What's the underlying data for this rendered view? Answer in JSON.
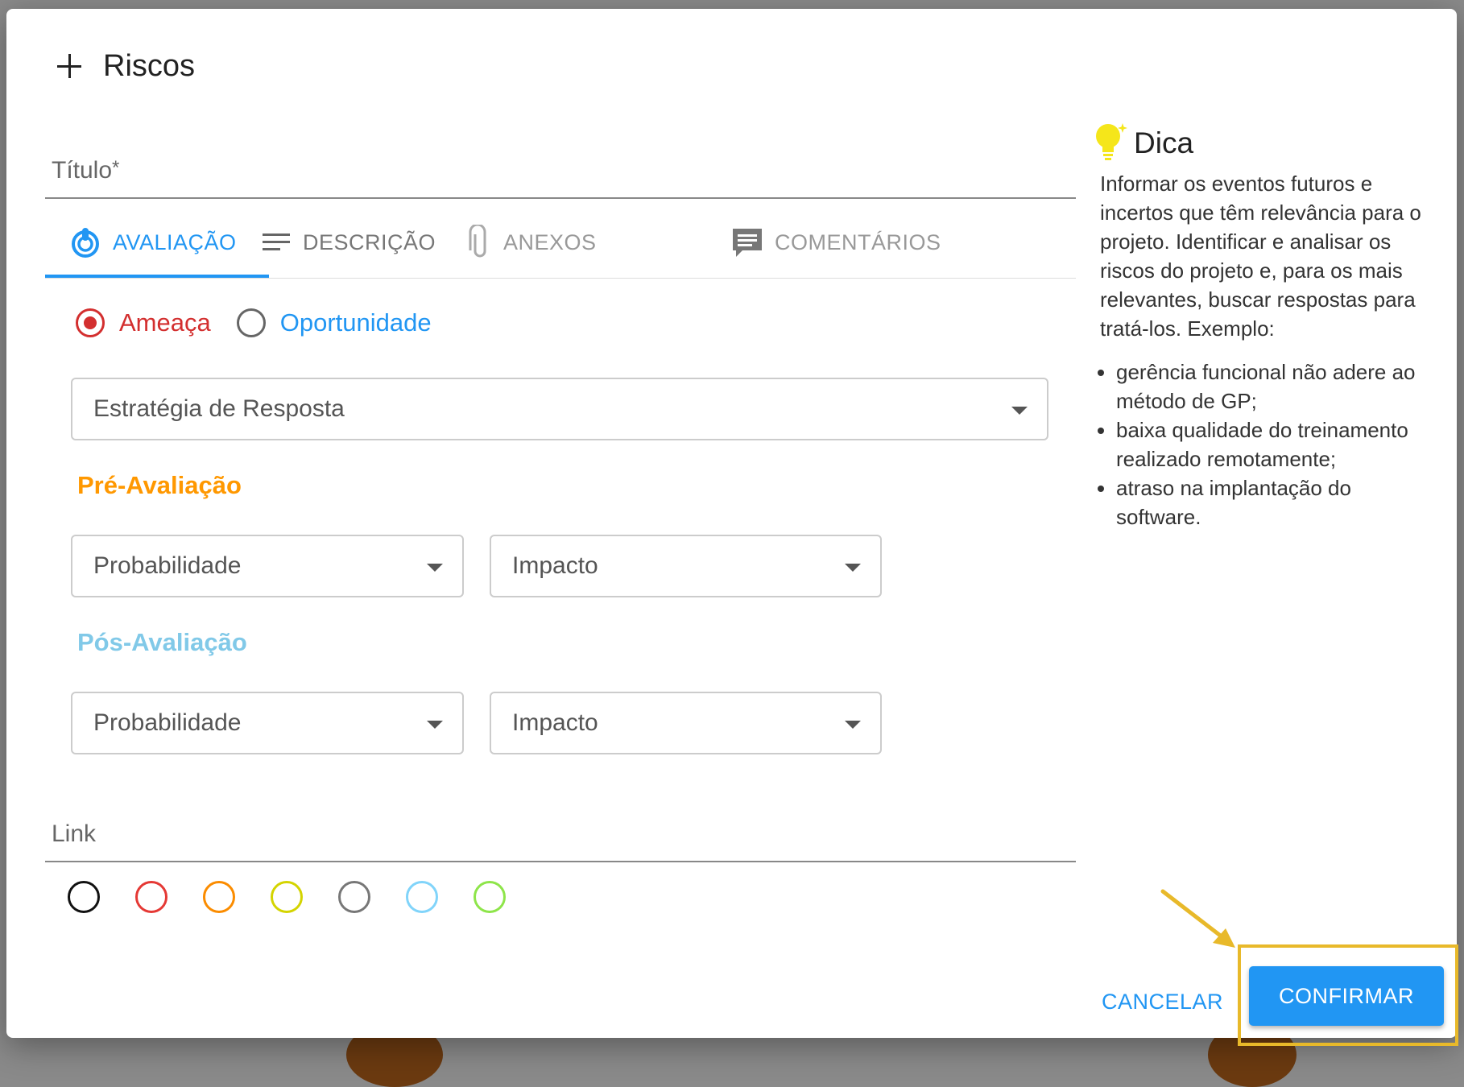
{
  "dialog": {
    "title": "Riscos",
    "titulo_label": "Título",
    "titulo_required": "*",
    "tabs": [
      {
        "label": "AVALIAÇÃO",
        "icon": "target-icon",
        "active": true
      },
      {
        "label": "DESCRIÇÃO",
        "icon": "lines-icon",
        "active": false
      },
      {
        "label": "ANEXOS",
        "icon": "paperclip-icon",
        "active": false
      },
      {
        "label": "COMENTÁRIOS",
        "icon": "comment-icon",
        "active": false
      }
    ],
    "radio": {
      "ameaca": "Ameaça",
      "oportunidade": "Oportunidade"
    },
    "estrategia_placeholder": "Estratégia de Resposta",
    "pre": {
      "label": "Pré-Avaliação",
      "probabilidade": "Probabilidade",
      "impacto": "Impacto"
    },
    "pos": {
      "label": "Pós-Avaliação",
      "probabilidade": "Probabilidade",
      "impacto": "Impacto"
    },
    "link_label": "Link",
    "colors": [
      "#111111",
      "#e53935",
      "#fb8c00",
      "#d4d400",
      "#777777",
      "#81d4fa",
      "#8ee54a"
    ],
    "cancel_label": "CANCELAR",
    "confirm_label": "CONFIRMAR"
  },
  "tip": {
    "title": "Dica",
    "body": "Informar os eventos futuros e incertos que têm relevância para o projeto. Identificar e analisar os riscos do projeto e, para os mais relevantes, buscar respostas para tratá-los. Exemplo:",
    "items": [
      "gerência funcional não adere ao método de GP;",
      "baixa qualidade do treinamento realizado remotamente;",
      "atraso na implantação do software."
    ]
  },
  "theme": {
    "primary": "#2196f3",
    "threat": "#d32f2f",
    "pre_color": "#ff9800",
    "pos_color": "#81c9e8",
    "highlight": "#e8b92a"
  }
}
